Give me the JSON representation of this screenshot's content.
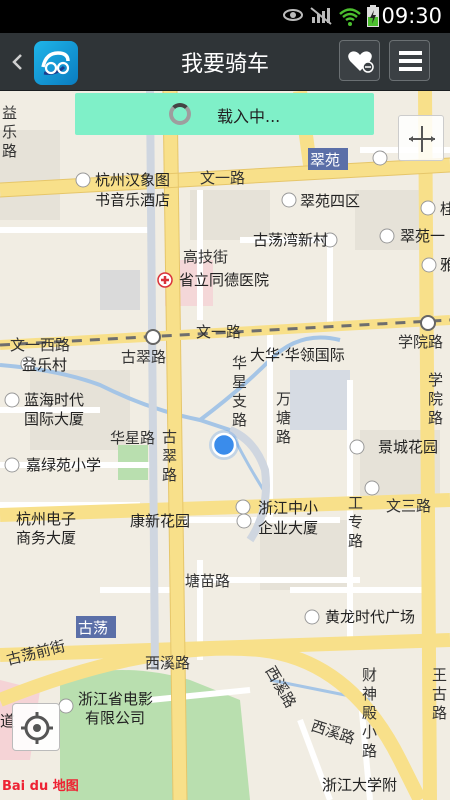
{
  "status_bar": {
    "time": "09:30",
    "icons": [
      "eye-icon",
      "signal-muted-icon",
      "wifi-icon",
      "battery-charging-icon"
    ]
  },
  "header": {
    "title": "我要骑车",
    "back_icon": "chevron-left-icon",
    "logo_icon": "app-logo-icon",
    "fav_icon": "favorite-heart-icon",
    "menu_icon": "menu-icon"
  },
  "loading": {
    "text": "载入中..."
  },
  "map": {
    "road_labels": {
      "wenyi_top": "文一路",
      "wenyi_west": "文一西路",
      "wenyi_mid": "文一路",
      "cuiyuan": "翠苑",
      "gucui": "古翠路",
      "gucui_v1": "古",
      "gucui_v2": "翠",
      "gucui_v3": "路",
      "huaxing": "华星路",
      "huaxingzhi_1": "华",
      "huaxingzhi_2": "星",
      "huaxingzhi_3": "支",
      "huaxingzhi_4": "路",
      "wantang_1": "万",
      "wantang_2": "塘",
      "wantang_3": "路",
      "xueyuan": "学院路",
      "xueyuan_v1": "学",
      "xueyuan_v2": "院",
      "xueyuan_v3": "路",
      "wensan": "文三路",
      "gongzhuan_1": "工",
      "gongzhuan_2": "专",
      "gongzhuan_3": "路",
      "tangmiao": "塘苗路",
      "gudang": "古荡",
      "gudangqian": "古荡前街",
      "xixi": "西溪路",
      "xixi2": "西溪路",
      "xixi3": "西溪路",
      "caishendian_1": "财",
      "caishendian_2": "神",
      "caishendian_3": "殿",
      "caishendian_4": "小",
      "caishendian_5": "路",
      "wanggu_1": "王",
      "wanggu_2": "古",
      "wanggu_3": "路",
      "yile_1": "益",
      "yile_2": "乐",
      "yile_3": "路",
      "gaoji": "高技街"
    },
    "pois": {
      "hangzhou_hanxiang": "杭州汉象图",
      "shuyinle": "书音乐酒店",
      "cuiyuan4": "翠苑四区",
      "gudangwan": "古荡湾新村",
      "cuiyuan1": "翠苑一",
      "tongde": "省立同德医院",
      "yilecun": "益乐村",
      "dahua": "大华·华领国际",
      "lanhai_1": "蓝海时代",
      "lanhai_2": "国际大厦",
      "jingcheng": "景城花园",
      "jialvyuan": "嘉绿苑小学",
      "hzdianzi_1": "杭州电子",
      "hzdianzi_2": "商务大厦",
      "kangxin": "康新花园",
      "zjzx_1": "浙江中小",
      "zjzx_2": "企业大厦",
      "huanglong": "黄龙时代广场",
      "zjdianying_1": "浙江省电影",
      "zjdianying_2": "有限公司",
      "zjdx": "浙江大学附",
      "dao": "道",
      "ya": "雅",
      "gui": "桂"
    },
    "brand": "Bai du 地图"
  },
  "controls": {
    "zoom_icon": "expand-arrows-icon",
    "locate_icon": "locate-target-icon"
  }
}
